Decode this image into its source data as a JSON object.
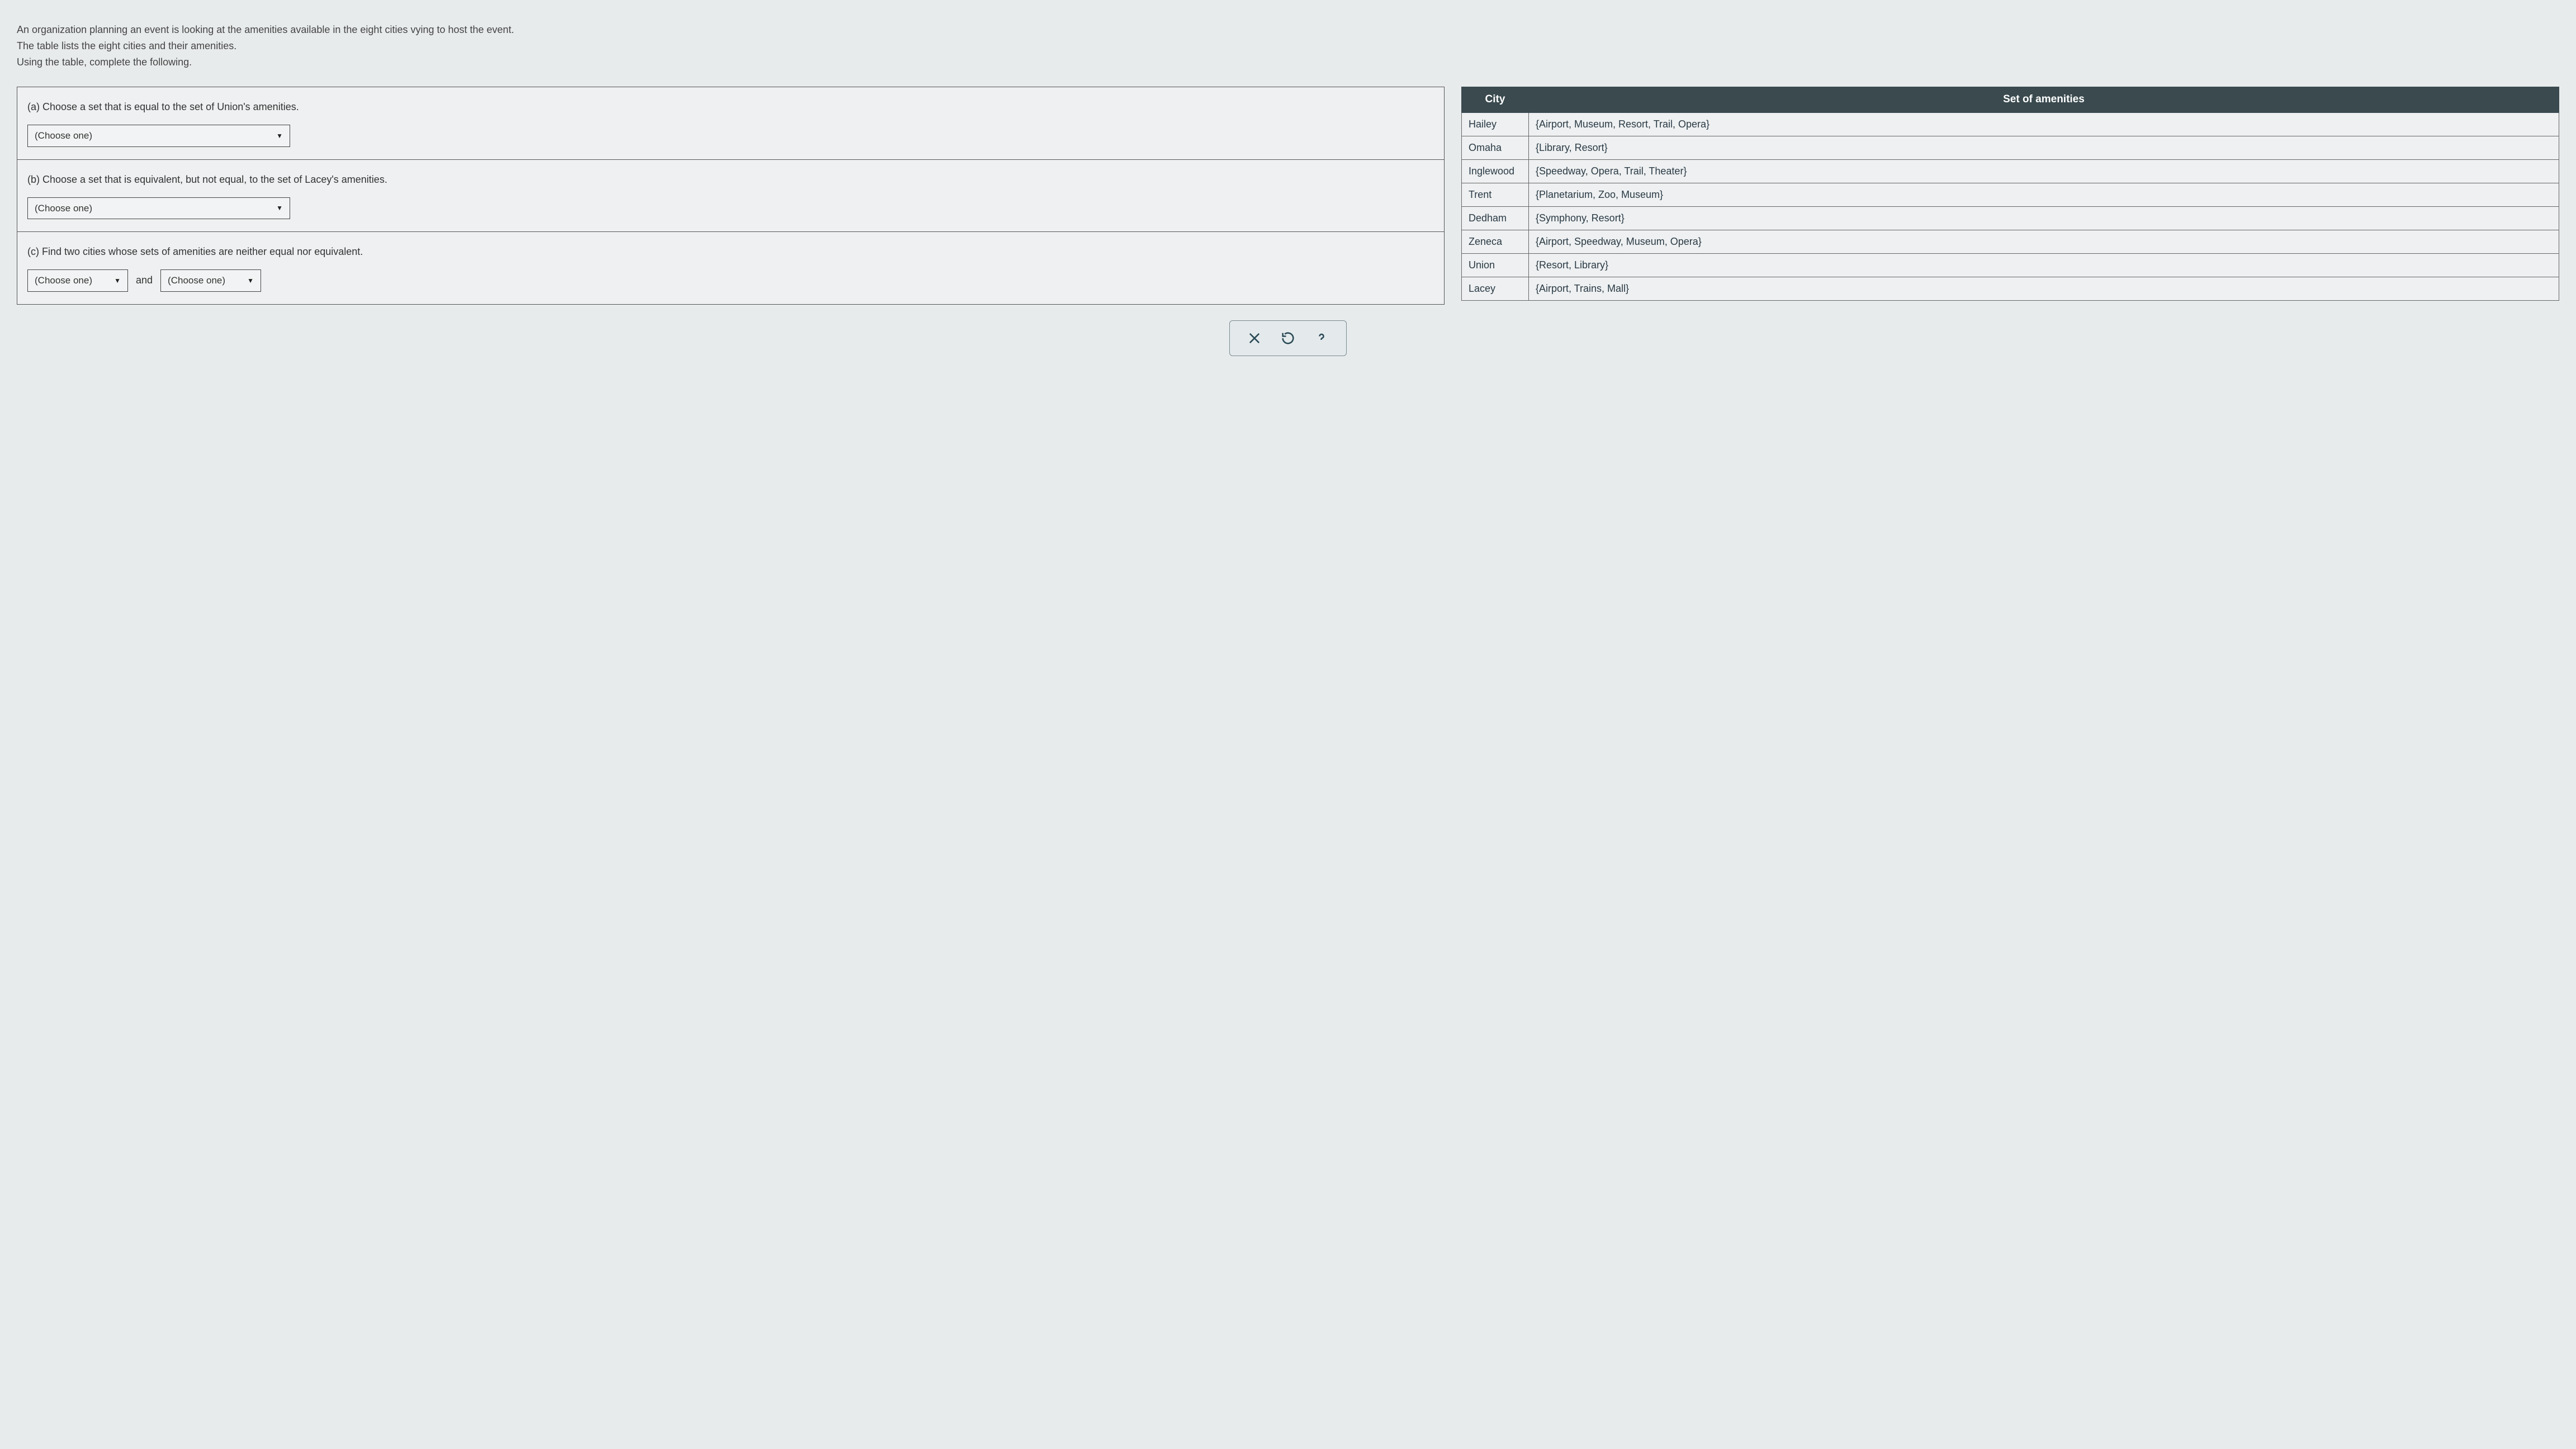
{
  "intro": {
    "line1": "An organization planning an event is looking at the amenities available in the eight cities vying to host the event.",
    "line2": "The table lists the eight cities and their amenities.",
    "line3": "Using the table, complete the following."
  },
  "questions": {
    "a": {
      "text": "(a)  Choose a set that is equal to the set of Union's amenities.",
      "select_label": "(Choose one)"
    },
    "b": {
      "text": "(b)  Choose a set that is equivalent, but not equal, to the set of Lacey's amenities.",
      "select_label": "(Choose one)"
    },
    "c": {
      "text": "(c)  Find two cities whose sets of amenities are neither equal nor equivalent.",
      "select1_label": "(Choose one)",
      "and": "and",
      "select2_label": "(Choose one)"
    }
  },
  "table": {
    "headers": {
      "city": "City",
      "amenities": "Set of amenities"
    },
    "rows": [
      {
        "city": "Hailey",
        "amenities": "{Airport, Museum, Resort, Trail, Opera}"
      },
      {
        "city": "Omaha",
        "amenities": "{Library, Resort}"
      },
      {
        "city": "Inglewood",
        "amenities": "{Speedway, Opera, Trail, Theater}"
      },
      {
        "city": "Trent",
        "amenities": "{Planetarium, Zoo, Museum}"
      },
      {
        "city": "Dedham",
        "amenities": "{Symphony, Resort}"
      },
      {
        "city": "Zeneca",
        "amenities": "{Airport, Speedway, Museum, Opera}"
      },
      {
        "city": "Union",
        "amenities": "{Resort, Library}"
      },
      {
        "city": "Lacey",
        "amenities": "{Airport, Trains, Mall}"
      }
    ]
  },
  "toolbar": {
    "clear": "Clear",
    "reset": "Reset",
    "help": "Help"
  }
}
